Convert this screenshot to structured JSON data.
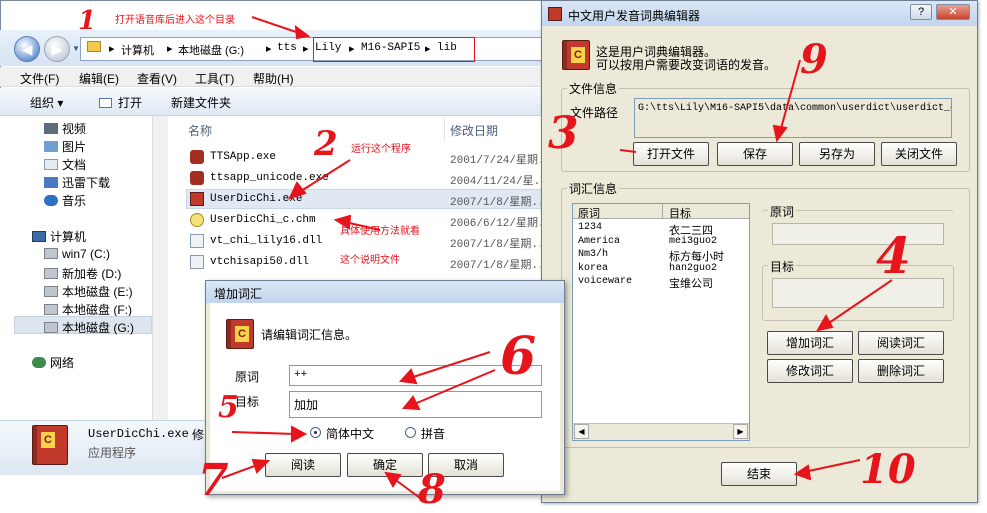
{
  "explorer": {
    "address": [
      "计算机",
      "本地磁盘 (G:)",
      "tts",
      "Lily",
      "M16-SAPI5",
      "lib"
    ],
    "menu": [
      "文件(F)",
      "编辑(E)",
      "查看(V)",
      "工具(T)",
      "帮助(H)"
    ],
    "toolbar": {
      "organize": "组织 ▾",
      "open": "打开",
      "new_folder": "新建文件夹"
    },
    "nav_items": [
      "视频",
      "图片",
      "文档",
      "迅雷下载",
      "音乐",
      "计算机",
      "win7 (C:)",
      "新加卷 (D:)",
      "本地磁盘 (E:)",
      "本地磁盘 (F:)",
      "本地磁盘 (G:)",
      "网络"
    ],
    "columns": {
      "name": "名称",
      "date": "修改日期"
    },
    "files": [
      {
        "name": "TTSApp.exe",
        "date": "2001/7/24/星期..."
      },
      {
        "name": "ttsapp_unicode.exe",
        "date": "2004/11/24/星..."
      },
      {
        "name": "UserDicChi.exe",
        "date": "2007/1/8/星期..."
      },
      {
        "name": "UserDicChi_c.chm",
        "date": "2006/6/12/星期..."
      },
      {
        "name": "vt_chi_lily16.dll",
        "date": "2007/1/8/星期..."
      },
      {
        "name": "vtchisapi50.dll",
        "date": "2007/1/8/星期..."
      }
    ],
    "details": {
      "name": "UserDicChi.exe",
      "extra": "修",
      "type": "应用程序"
    }
  },
  "dialog": {
    "title": "中文用户发音词典编辑器",
    "intro1": "这是用户词典编辑器。",
    "intro2": "可以按用户需要改变词语的发音。",
    "file_group": "文件信息",
    "path_label": "文件路径",
    "path_value": "G:\\tts\\Lily\\M16-SAPI5\\data\\common\\userdict\\userdict_c",
    "buttons": {
      "open": "打开文件",
      "save": "保存",
      "save_as": "另存为",
      "close_file": "关闭文件"
    },
    "vocab_group": "词汇信息",
    "list_headers": {
      "orig": "原词",
      "target": "目标"
    },
    "entries": [
      {
        "orig": "1234",
        "target": "衣二三四"
      },
      {
        "orig": "America",
        "target": "mei3guo2"
      },
      {
        "orig": "Nm3/h",
        "target": "标方每小时"
      },
      {
        "orig": "korea",
        "target": "han2guo2"
      },
      {
        "orig": "voiceware",
        "target": "宝维公司"
      }
    ],
    "orig_label": "原词",
    "target_label": "目标",
    "word_buttons": {
      "add": "增加词汇",
      "read": "阅读词汇",
      "modify": "修改词汇",
      "delete": "删除词汇"
    },
    "end": "结束"
  },
  "add_dialog": {
    "title": "增加词汇",
    "prompt": "请编辑词汇信息。",
    "orig_label": "原词",
    "orig_value": "++",
    "target_label": "目标",
    "target_value": "加加",
    "radio_chinese": "简体中文",
    "radio_pinyin": "拼音",
    "buttons": {
      "read": "阅读",
      "ok": "确定",
      "cancel": "取消"
    }
  },
  "annotations": {
    "top_note": "打开语音库后进入这个目录",
    "run_note": "运行这个程序",
    "usage_note": "具体使用方法就看",
    "doc_note": "这个说明文件",
    "numbers": [
      "1",
      "2",
      "3",
      "4",
      "5",
      "6",
      "7",
      "8",
      "9",
      "10"
    ]
  },
  "colors": {
    "annotation": "#e8141b",
    "dialog_bg": "#ece9d8",
    "title_bar": "#c2d5ee"
  }
}
